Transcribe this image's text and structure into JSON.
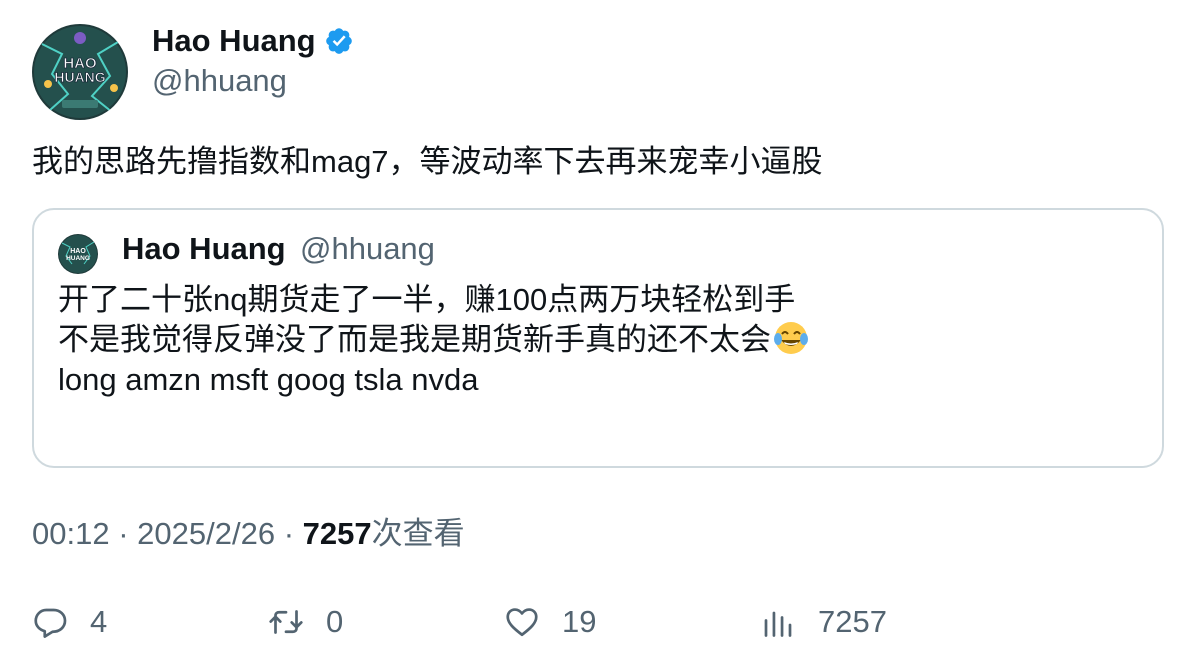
{
  "tweet": {
    "author": {
      "display_name": "Hao Huang",
      "handle": "@hhuang",
      "avatar_text": [
        "HAO",
        "HUANG"
      ],
      "verified_icon": "verified-badge-icon"
    },
    "text": "我的思路先撸指数和mag7，等波动率下去再来宠幸小逼股",
    "quoted": {
      "author": {
        "display_name": "Hao Huang",
        "handle": "@hhuang"
      },
      "lines": [
        "开了二十张nq期货走了一半，赚100点两万块轻松到手",
        "不是我觉得反弹没了而是我是期货新手真的还不太会",
        "long amzn msft goog tsla nvda"
      ],
      "emoji": "face-with-tears-of-joy"
    },
    "meta": {
      "time": "00:12",
      "date": "2025/2/26",
      "separator": "·",
      "views_count": "7257",
      "views_label": "次查看"
    },
    "actions": {
      "reply": {
        "count": "4",
        "icon": "reply-icon"
      },
      "retweet": {
        "count": "0",
        "icon": "retweet-icon"
      },
      "like": {
        "count": "19",
        "icon": "heart-icon"
      },
      "views": {
        "count": "7257",
        "icon": "analytics-icon"
      }
    },
    "colors": {
      "text": "#0f1419",
      "secondary": "#536471",
      "verified": "#1d9bf0",
      "border": "#cfd9de"
    }
  }
}
